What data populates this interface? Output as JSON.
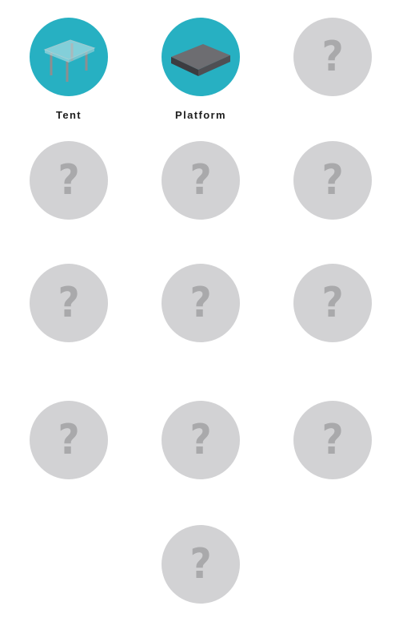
{
  "items": [
    {
      "label": "Tent",
      "unlocked": true,
      "icon": "glass-table-icon"
    },
    {
      "label": "Platform",
      "unlocked": true,
      "icon": "platform-icon"
    },
    {
      "label": "",
      "unlocked": false,
      "icon": "question-mark-icon",
      "glyph": "?"
    },
    {
      "label": "",
      "unlocked": false,
      "icon": "question-mark-icon",
      "glyph": "?"
    },
    {
      "label": "",
      "unlocked": false,
      "icon": "question-mark-icon",
      "glyph": "?"
    },
    {
      "label": "",
      "unlocked": false,
      "icon": "question-mark-icon",
      "glyph": "?"
    },
    {
      "label": "",
      "unlocked": false,
      "icon": "question-mark-icon",
      "glyph": "?"
    },
    {
      "label": "",
      "unlocked": false,
      "icon": "question-mark-icon",
      "glyph": "?"
    },
    {
      "label": "",
      "unlocked": false,
      "icon": "question-mark-icon",
      "glyph": "?"
    },
    {
      "label": "",
      "unlocked": false,
      "icon": "question-mark-icon",
      "glyph": "?"
    },
    {
      "label": "",
      "unlocked": false,
      "icon": "question-mark-icon",
      "glyph": "?"
    },
    {
      "label": "",
      "unlocked": false,
      "icon": "question-mark-icon",
      "glyph": "?"
    },
    {
      "label": "",
      "unlocked": false,
      "icon": "question-mark-icon",
      "glyph": "?"
    }
  ],
  "colors": {
    "unlocked_bg": "#27b0c2",
    "locked_bg": "#d2d2d4",
    "question_mark": "#a9a9ab",
    "label_text": "#1e1e1e"
  }
}
